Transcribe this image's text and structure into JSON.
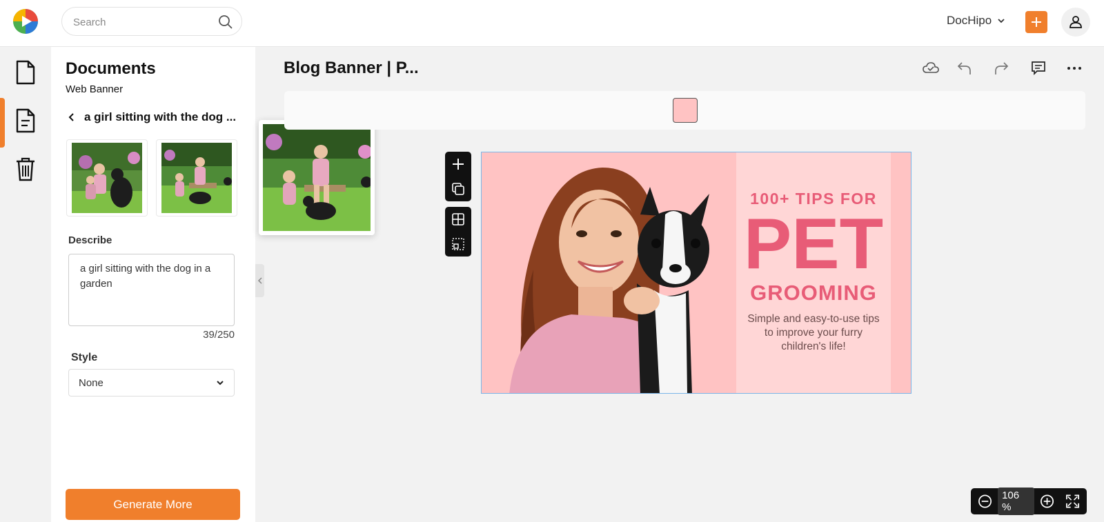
{
  "header": {
    "search": {
      "placeholder": "Search"
    },
    "workspace": "DocHipo"
  },
  "panel": {
    "title": "Documents",
    "subtitle": "Web Banner",
    "back_text": "a girl sitting with the dog ...",
    "describe_label": "Describe",
    "prompt_value": "a girl sitting with the dog in a garden",
    "char_count": "39/250",
    "style_label": "Style",
    "style_value": "None",
    "generate_label": "Generate More"
  },
  "editor": {
    "doc_title": "Blog Banner | P...",
    "swatch_color": "#ffc3c3"
  },
  "banner": {
    "line1": "100+ TIPS FOR",
    "line2": "PET",
    "line3": "GROOMING",
    "subtitle": "Simple and easy-to-use tips to improve your furry children's life!"
  },
  "zoom": {
    "value": "106 %"
  },
  "colors": {
    "accent": "#f07f2c",
    "banner_pink": "#e85c77",
    "banner_bg": "#ffc3c3"
  },
  "icons": [
    "logo",
    "search-icon",
    "chevron-down-icon",
    "plus-icon",
    "user-icon",
    "document-icon",
    "template-icon",
    "trash-icon",
    "back-chevron-icon",
    "cloud-check-icon",
    "undo-icon",
    "redo-icon",
    "comment-icon",
    "more-icon",
    "add-icon",
    "duplicate-icon",
    "grid-icon",
    "select-icon",
    "zoom-out-icon",
    "zoom-in-icon",
    "fullscreen-icon"
  ]
}
